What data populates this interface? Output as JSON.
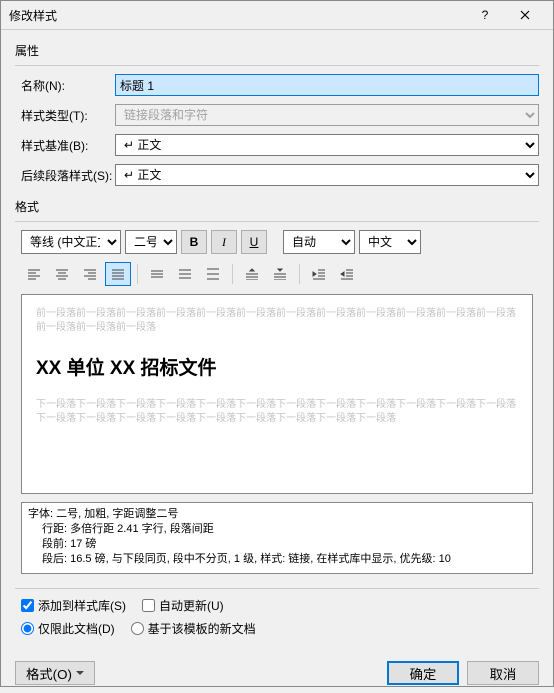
{
  "titlebar": {
    "title": "修改样式"
  },
  "sections": {
    "properties": "属性",
    "format": "格式"
  },
  "labels": {
    "name": "名称(N):",
    "style_type": "样式类型(T):",
    "based_on": "样式基准(B):",
    "following": "后续段落样式(S):"
  },
  "fields": {
    "name": "标题 1",
    "style_type": "链接段落和字符",
    "based_on": "↵ 正文",
    "following": "↵ 正文"
  },
  "format_toolbar": {
    "font": "等线 (中文正文)",
    "size": "二号",
    "color": "自动",
    "script": "中文"
  },
  "preview": {
    "before": "前一段落前一段落前一段落前一段落前一段落前一段落前一段落前一段落前一段落前一段落前一段落前一段落前一段落前一段落前一段落",
    "heading": "XX 单位 XX 招标文件",
    "after": "下一段落下一段落下一段落下一段落下一段落下一段落下一段落下一段落下一段落下一段落下一段落下一段落下一段落下一段落下一段落下一段落下一段落下一段落下一段落下一段落下一段落"
  },
  "description": {
    "line1": "字体: 二号, 加粗, 字距调整二号",
    "line2": "行距: 多倍行距 2.41 字行, 段落间距",
    "line3": "段前: 17 磅",
    "line4": "段后: 16.5 磅, 与下段同页, 段中不分页, 1 级, 样式: 链接, 在样式库中显示, 优先级: 10"
  },
  "checkboxes": {
    "add_to_library": "添加到样式库(S)",
    "auto_update": "自动更新(U)",
    "this_doc_only": "仅限此文档(D)",
    "template_based": "基于该模板的新文档"
  },
  "buttons": {
    "format": "格式(O)",
    "ok": "确定",
    "cancel": "取消"
  }
}
